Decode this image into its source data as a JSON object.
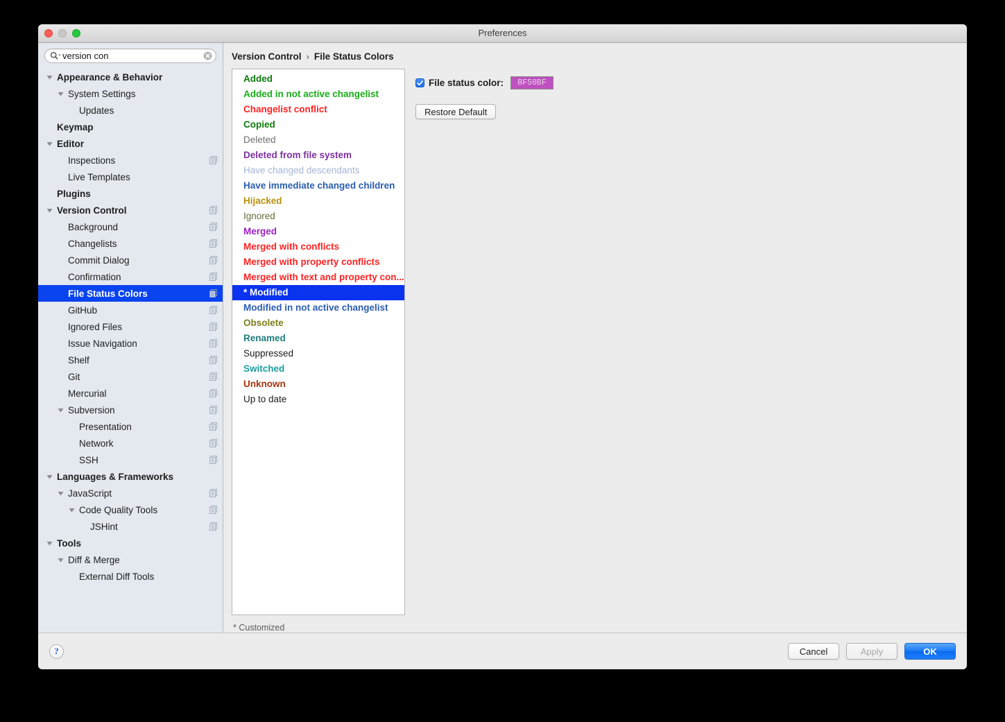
{
  "window": {
    "title": "Preferences",
    "traffic_lights": [
      "close-button",
      "minimize-button",
      "maximize-button"
    ]
  },
  "search": {
    "value": "version con",
    "placeholder": "",
    "icon": "search-icon",
    "clear_icon": "clear-icon"
  },
  "sidebar": {
    "items": [
      {
        "label": "Appearance & Behavior",
        "indent": 0,
        "twisty": "down",
        "bold": true,
        "scope": false,
        "selected": false
      },
      {
        "label": "System Settings",
        "indent": 1,
        "twisty": "down",
        "bold": false,
        "scope": false,
        "selected": false
      },
      {
        "label": "Updates",
        "indent": 2,
        "twisty": "none",
        "bold": false,
        "scope": false,
        "selected": false
      },
      {
        "label": "Keymap",
        "indent": 0,
        "twisty": "none",
        "bold": true,
        "scope": false,
        "selected": false
      },
      {
        "label": "Editor",
        "indent": 0,
        "twisty": "down",
        "bold": true,
        "scope": false,
        "selected": false
      },
      {
        "label": "Inspections",
        "indent": 1,
        "twisty": "none",
        "bold": false,
        "scope": true,
        "selected": false
      },
      {
        "label": "Live Templates",
        "indent": 1,
        "twisty": "none",
        "bold": false,
        "scope": false,
        "selected": false
      },
      {
        "label": "Plugins",
        "indent": 0,
        "twisty": "none",
        "bold": true,
        "scope": false,
        "selected": false
      },
      {
        "label": "Version Control",
        "indent": 0,
        "twisty": "down",
        "bold": true,
        "scope": true,
        "selected": false
      },
      {
        "label": "Background",
        "indent": 1,
        "twisty": "none",
        "bold": false,
        "scope": true,
        "selected": false
      },
      {
        "label": "Changelists",
        "indent": 1,
        "twisty": "none",
        "bold": false,
        "scope": true,
        "selected": false
      },
      {
        "label": "Commit Dialog",
        "indent": 1,
        "twisty": "none",
        "bold": false,
        "scope": true,
        "selected": false
      },
      {
        "label": "Confirmation",
        "indent": 1,
        "twisty": "none",
        "bold": false,
        "scope": true,
        "selected": false
      },
      {
        "label": "File Status Colors",
        "indent": 1,
        "twisty": "none",
        "bold": true,
        "scope": true,
        "selected": true
      },
      {
        "label": "GitHub",
        "indent": 1,
        "twisty": "none",
        "bold": false,
        "scope": true,
        "selected": false
      },
      {
        "label": "Ignored Files",
        "indent": 1,
        "twisty": "none",
        "bold": false,
        "scope": true,
        "selected": false
      },
      {
        "label": "Issue Navigation",
        "indent": 1,
        "twisty": "none",
        "bold": false,
        "scope": true,
        "selected": false
      },
      {
        "label": "Shelf",
        "indent": 1,
        "twisty": "none",
        "bold": false,
        "scope": true,
        "selected": false
      },
      {
        "label": "Git",
        "indent": 1,
        "twisty": "none",
        "bold": false,
        "scope": true,
        "selected": false
      },
      {
        "label": "Mercurial",
        "indent": 1,
        "twisty": "none",
        "bold": false,
        "scope": true,
        "selected": false
      },
      {
        "label": "Subversion",
        "indent": 1,
        "twisty": "down",
        "bold": false,
        "scope": true,
        "selected": false
      },
      {
        "label": "Presentation",
        "indent": 2,
        "twisty": "none",
        "bold": false,
        "scope": true,
        "selected": false
      },
      {
        "label": "Network",
        "indent": 2,
        "twisty": "none",
        "bold": false,
        "scope": true,
        "selected": false
      },
      {
        "label": "SSH",
        "indent": 2,
        "twisty": "none",
        "bold": false,
        "scope": true,
        "selected": false
      },
      {
        "label": "Languages & Frameworks",
        "indent": 0,
        "twisty": "down",
        "bold": true,
        "scope": false,
        "selected": false
      },
      {
        "label": "JavaScript",
        "indent": 1,
        "twisty": "down",
        "bold": false,
        "scope": true,
        "selected": false
      },
      {
        "label": "Code Quality Tools",
        "indent": 2,
        "twisty": "down",
        "bold": false,
        "scope": true,
        "selected": false
      },
      {
        "label": "JSHint",
        "indent": 3,
        "twisty": "none",
        "bold": false,
        "scope": true,
        "selected": false
      },
      {
        "label": "Tools",
        "indent": 0,
        "twisty": "down",
        "bold": true,
        "scope": false,
        "selected": false
      },
      {
        "label": "Diff & Merge",
        "indent": 1,
        "twisty": "down",
        "bold": false,
        "scope": false,
        "selected": false
      },
      {
        "label": "External Diff Tools",
        "indent": 2,
        "twisty": "none",
        "bold": false,
        "scope": false,
        "selected": false
      }
    ]
  },
  "breadcrumb": {
    "parent": "Version Control",
    "separator": "›",
    "current": "File Status Colors"
  },
  "status_list": {
    "items": [
      {
        "label": "Added",
        "color": "#0c7a0c",
        "bold": true,
        "selected": false
      },
      {
        "label": "Added in not active changelist",
        "color": "#18ad18",
        "bold": true,
        "selected": false
      },
      {
        "label": "Changelist conflict",
        "color": "#ff2222",
        "bold": true,
        "selected": false
      },
      {
        "label": "Copied",
        "color": "#0c7a0c",
        "bold": true,
        "selected": false
      },
      {
        "label": "Deleted",
        "color": "#6f6f6f",
        "bold": false,
        "selected": false
      },
      {
        "label": "Deleted from file system",
        "color": "#7b2f9e",
        "bold": true,
        "selected": false
      },
      {
        "label": "Have changed descendants",
        "color": "#a3b5d6",
        "bold": false,
        "selected": false
      },
      {
        "label": "Have immediate changed children",
        "color": "#2a5db0",
        "bold": true,
        "selected": false
      },
      {
        "label": "Hijacked",
        "color": "#b8910c",
        "bold": true,
        "selected": false
      },
      {
        "label": "Ignored",
        "color": "#6a6a3a",
        "bold": false,
        "selected": false
      },
      {
        "label": "Merged",
        "color": "#9b20c4",
        "bold": true,
        "selected": false
      },
      {
        "label": "Merged with conflicts",
        "color": "#ff2222",
        "bold": true,
        "selected": false
      },
      {
        "label": "Merged with property conflicts",
        "color": "#ff2222",
        "bold": true,
        "selected": false
      },
      {
        "label": "Merged with text and property con...",
        "color": "#ff2222",
        "bold": true,
        "selected": false
      },
      {
        "label": "* Modified",
        "color": "#ffffff",
        "bold": true,
        "selected": true
      },
      {
        "label": "Modified in not active changelist",
        "color": "#2a5db0",
        "bold": true,
        "selected": false
      },
      {
        "label": "Obsolete",
        "color": "#7d7d1b",
        "bold": true,
        "selected": false
      },
      {
        "label": "Renamed",
        "color": "#1f7d7d",
        "bold": true,
        "selected": false
      },
      {
        "label": "Suppressed",
        "color": "#1d1d1d",
        "bold": false,
        "selected": false
      },
      {
        "label": "Switched",
        "color": "#1d9e9e",
        "bold": true,
        "selected": false
      },
      {
        "label": "Unknown",
        "color": "#a8340d",
        "bold": true,
        "selected": false
      },
      {
        "label": "Up to date",
        "color": "#1d1d1d",
        "bold": false,
        "selected": false
      }
    ],
    "footer_note": "* Customized"
  },
  "settings": {
    "checkbox_checked": true,
    "color_label": "File status color:",
    "color_value": "BF50BF",
    "color_swatch_hex": "#BF50BF",
    "restore_button": "Restore Default"
  },
  "footer": {
    "help_label": "?",
    "cancel": "Cancel",
    "apply": "Apply",
    "ok": "OK"
  }
}
